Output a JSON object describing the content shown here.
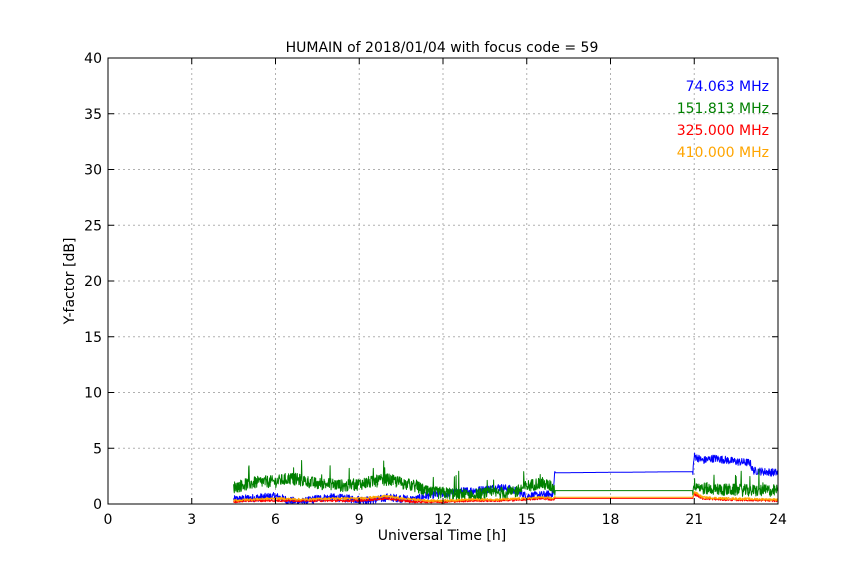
{
  "chart_data": {
    "type": "line",
    "title": "HUMAIN of 2018/01/04 with focus code = 59",
    "xlabel": "Universal Time [h]",
    "ylabel": "Y-factor [dB]",
    "xlim": [
      0,
      24
    ],
    "ylim": [
      0,
      40
    ],
    "xticks": [
      0,
      3,
      6,
      9,
      12,
      15,
      18,
      21,
      24
    ],
    "yticks": [
      0,
      5,
      10,
      15,
      20,
      25,
      30,
      35,
      40
    ],
    "grid": true,
    "legend_position": "top-right",
    "series": [
      {
        "name": "74.063 MHz",
        "color": "#0000ff",
        "x": [
          4.5,
          5.0,
          5.5,
          6.0,
          6.5,
          7.0,
          7.5,
          8.0,
          8.5,
          9.0,
          9.5,
          10.0,
          10.5,
          11.0,
          11.5,
          12.0,
          12.5,
          13.0,
          13.5,
          14.0,
          14.5,
          15.0,
          15.5,
          15.95,
          16.0,
          20.95,
          21.0,
          21.3,
          21.7,
          22.0,
          22.5,
          23.0,
          23.1,
          23.5,
          24.0
        ],
        "y": [
          0.4,
          0.5,
          0.6,
          0.7,
          0.3,
          0.2,
          0.5,
          0.6,
          0.5,
          0.4,
          0.3,
          0.6,
          0.5,
          0.4,
          0.8,
          0.9,
          1.1,
          1.2,
          1.3,
          1.5,
          1.3,
          0.7,
          0.8,
          0.9,
          2.8,
          2.9,
          4.3,
          3.9,
          4.1,
          4.0,
          3.8,
          3.7,
          3.0,
          2.9,
          2.8
        ],
        "noise": 0.35
      },
      {
        "name": "151.813 MHz",
        "color": "#008000",
        "x": [
          4.5,
          5.0,
          5.5,
          6.0,
          6.5,
          7.0,
          7.5,
          8.0,
          8.5,
          9.0,
          9.5,
          10.0,
          10.5,
          11.0,
          11.5,
          12.0,
          12.5,
          13.0,
          13.5,
          14.0,
          14.5,
          15.0,
          15.5,
          15.95,
          16.0,
          20.95,
          21.0,
          21.3,
          22.0,
          23.0,
          24.0
        ],
        "y": [
          1.5,
          1.8,
          2.0,
          2.0,
          2.3,
          2.1,
          1.8,
          1.8,
          1.6,
          1.8,
          2.0,
          2.2,
          1.9,
          1.6,
          1.0,
          1.0,
          0.9,
          0.8,
          0.9,
          1.0,
          1.0,
          1.6,
          1.9,
          1.5,
          1.2,
          1.2,
          1.8,
          1.4,
          1.3,
          1.2,
          1.2
        ],
        "noise": 0.55
      },
      {
        "name": "325.000 MHz",
        "color": "#ff0000",
        "x": [
          4.5,
          5.0,
          6.0,
          7.0,
          8.0,
          9.0,
          9.5,
          10.0,
          10.5,
          11.0,
          11.5,
          12.0,
          13.0,
          14.0,
          15.0,
          15.5,
          15.95,
          16.0,
          20.95,
          21.0,
          21.3,
          22.0,
          24.0
        ],
        "y": [
          0.2,
          0.3,
          0.3,
          0.3,
          0.3,
          0.3,
          0.4,
          0.5,
          0.3,
          0.2,
          0.2,
          0.2,
          0.3,
          0.3,
          0.4,
          0.5,
          0.4,
          0.5,
          0.5,
          0.9,
          0.5,
          0.4,
          0.3
        ],
        "noise": 0.1
      },
      {
        "name": "410.000 MHz",
        "color": "#ffa500",
        "x": [
          4.5,
          5.0,
          6.0,
          7.0,
          8.0,
          9.0,
          9.5,
          10.0,
          10.5,
          11.0,
          11.5,
          12.0,
          13.0,
          14.0,
          15.0,
          15.5,
          15.95,
          16.0,
          20.95,
          21.0,
          21.3,
          22.0,
          24.0
        ],
        "y": [
          0.3,
          0.4,
          0.5,
          0.4,
          0.5,
          0.5,
          0.6,
          0.7,
          0.5,
          0.4,
          0.3,
          0.3,
          0.4,
          0.4,
          0.5,
          0.6,
          0.5,
          0.6,
          0.6,
          1.1,
          0.6,
          0.5,
          0.4
        ],
        "noise": 0.1
      }
    ]
  }
}
